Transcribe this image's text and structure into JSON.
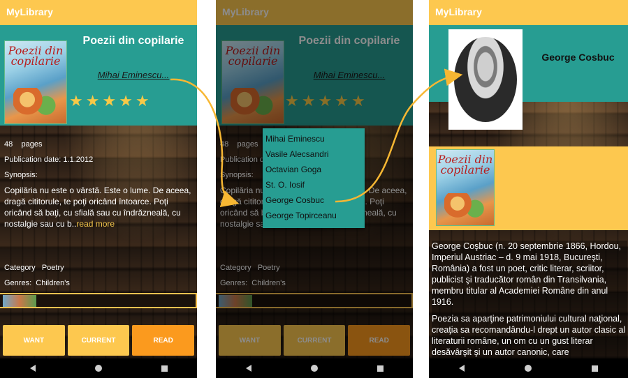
{
  "app_title": "MyLibrary",
  "book": {
    "title": "Poezii din copilarie",
    "cover_title": "Poezii din copilarie",
    "author": "Mihai Eminescu...",
    "stars": [
      "★",
      "★",
      "★",
      "★",
      "★"
    ],
    "pages_num": "48",
    "pages_label": "pages",
    "pub_label": "Publication date:",
    "pub_date": "1.1.2012",
    "synopsis_label": "Synopsis:",
    "synopsis_text": "Copilăria nu este o vârstă. Este o lume. De aceea, dragă cititorule, te poţi oricând întoarce. Poţi oricând să baţi, cu sfială sau cu îndrăzneală, cu nostalgie sau cu b..",
    "read_more": "read more",
    "category_label": "Category",
    "category_value": "Poetry",
    "genres_label": "Genres:",
    "genres_value": "Children's"
  },
  "buttons": {
    "want": "WANT",
    "current": "CURRENT",
    "read": "READ"
  },
  "authors_menu": [
    "Mihai Eminescu",
    "Vasile Alecsandri",
    "Octavian Goga",
    "St. O. Iosif",
    "George Cosbuc",
    "George Topirceanu"
  ],
  "author_page": {
    "name": "George Cosbuc",
    "bio_1": "George Coşbuc (n. 20 septembrie 1866, Hordou, Imperiul Austriac – d. 9 mai 1918, Bucureşti, România) a fost un poet, critic literar, scriitor, publicist şi traducător român din Transilvania, membru titular al Academiei Române din anul 1916.",
    "bio_2": "Poezia sa aparţine patrimoniului cultural naţional, creaţia sa recomandându-l drept un autor clasic al literaturii române, un om cu un gust literar desăvârşit şi un autor canonic, care"
  },
  "colors": {
    "appbar": "#fdc84f",
    "teal": "#279d92",
    "accent": "#fb9a1e",
    "arrow": "#f7b733"
  }
}
